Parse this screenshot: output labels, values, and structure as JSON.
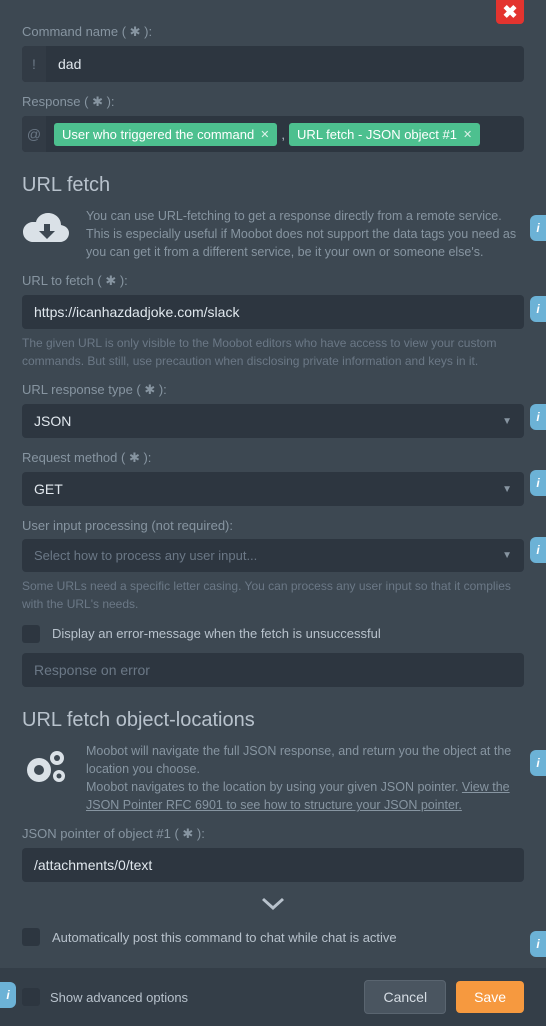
{
  "close_x": "✖",
  "command_name": {
    "label": "Command name ( ✱ ):",
    "prefix": "!",
    "value": "dad"
  },
  "response": {
    "label": "Response ( ✱ ):",
    "prefix": "@",
    "tags": [
      "User who triggered the command",
      "URL fetch - JSON object #1"
    ],
    "sep": ","
  },
  "url_fetch": {
    "title": "URL fetch",
    "info1": "You can use URL-fetching to get a response directly from a remote service.",
    "info2": "This is especially useful if Moobot does not support the data tags you need as you can get it from a different service, be it your own or someone else's.",
    "url_label": "URL to fetch ( ✱ ):",
    "url_value": "https://icanhazdadjoke.com/slack",
    "url_hint": "The given URL is only visible to the Moobot editors who have access to view your custom commands. But still, use precaution when disclosing private information and keys in it.",
    "resp_type_label": "URL response type ( ✱ ):",
    "resp_type_value": "JSON",
    "method_label": "Request method ( ✱ ):",
    "method_value": "GET",
    "input_proc_label": "User input processing (not required):",
    "input_proc_placeholder": "Select how to process any user input...",
    "input_proc_hint": "Some URLs need a specific letter casing. You can process any user input so that it complies with the URL's needs.",
    "error_checkbox": "Display an error-message when the fetch is unsuccessful",
    "error_placeholder": "Response on error"
  },
  "obj_loc": {
    "title": "URL fetch object-locations",
    "info1": "Moobot will navigate the full JSON response, and return you the object at the location you choose.",
    "info2a": "Moobot navigates to the location by using your given JSON pointer. ",
    "info2b": "View the JSON Pointer RFC 6901 to see how to structure your JSON pointer.",
    "ptr_label": "JSON pointer of object #1 ( ✱ ):",
    "ptr_value": "/attachments/0/text"
  },
  "auto_post": "Automatically post this command to chat while chat is active",
  "advanced": "Show advanced options",
  "cancel": "Cancel",
  "save": "Save"
}
